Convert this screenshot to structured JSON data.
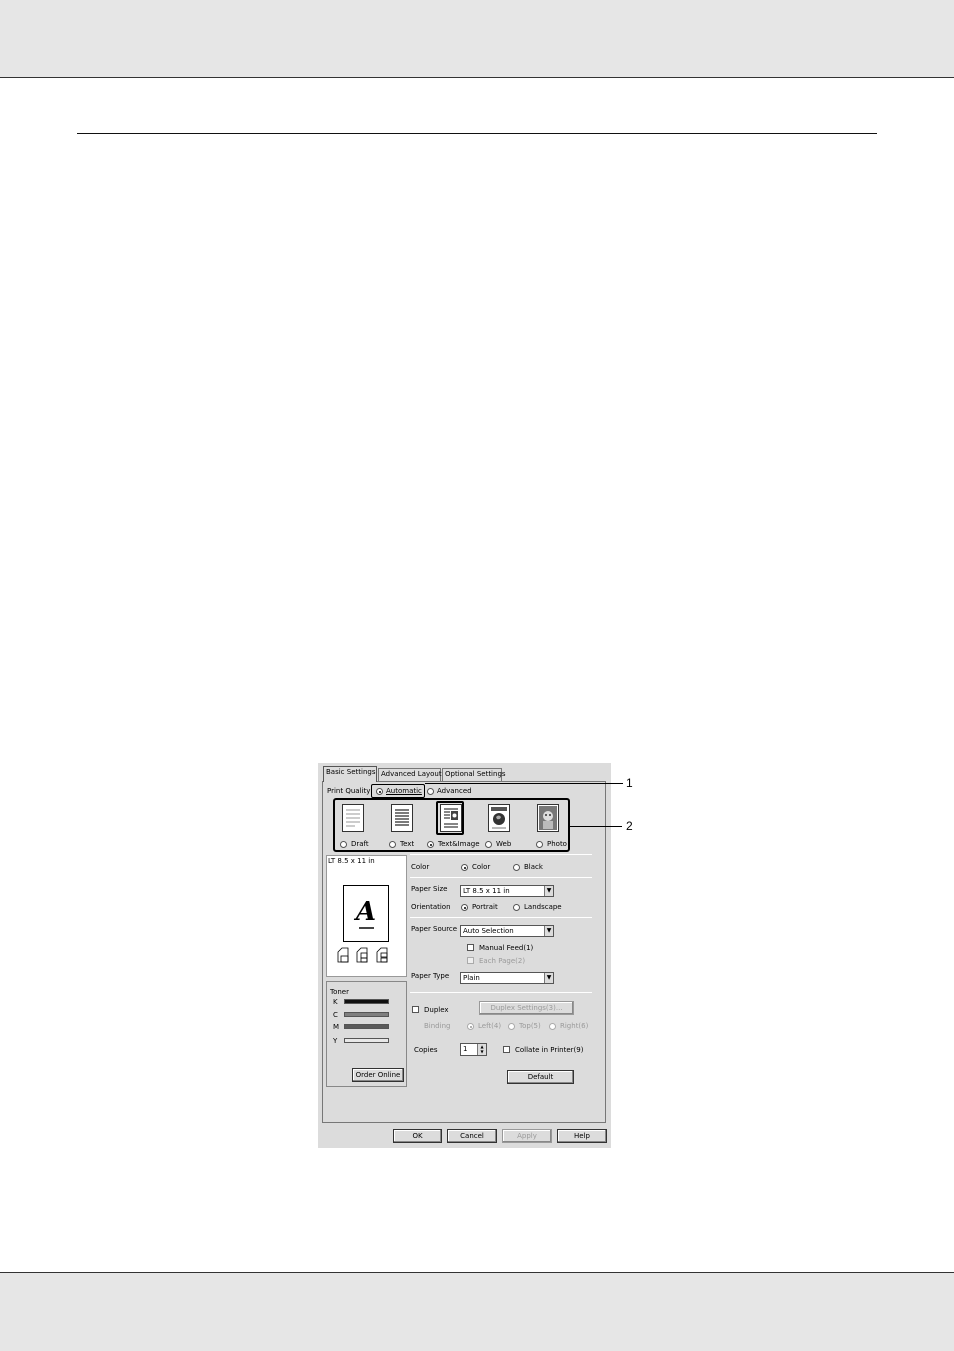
{
  "dialog": {
    "tabs": [
      "Basic Settings",
      "Advanced Layout",
      "Optional Settings"
    ],
    "print_quality": {
      "label": "Print Quality",
      "modes": [
        {
          "label": "Automatic",
          "selected": true
        },
        {
          "label": "Advanced",
          "selected": false
        }
      ],
      "options": [
        {
          "label": "Draft",
          "selected": false,
          "icon": "document-lines-icon"
        },
        {
          "label": "Text",
          "selected": false,
          "icon": "text-page-icon"
        },
        {
          "label": "Text&Image",
          "selected": true,
          "icon": "text-image-page-icon"
        },
        {
          "label": "Web",
          "selected": false,
          "icon": "globe-page-icon"
        },
        {
          "label": "Photo",
          "selected": false,
          "icon": "photo-icon"
        }
      ]
    },
    "preview": {
      "paper_label": "LT 8.5 x 11 in",
      "letter": "A"
    },
    "color": {
      "label": "Color",
      "options": [
        {
          "label": "Color",
          "selected": true
        },
        {
          "label": "Black",
          "selected": false
        }
      ]
    },
    "paper_size": {
      "label": "Paper Size",
      "value": "LT 8.5 x 11 in"
    },
    "orientation": {
      "label": "Orientation",
      "options": [
        {
          "label": "Portrait",
          "selected": true
        },
        {
          "label": "Landscape",
          "selected": false
        }
      ]
    },
    "paper_source": {
      "label": "Paper Source",
      "value": "Auto Selection"
    },
    "manual_feed": {
      "label": "Manual Feed(1)",
      "checked": false
    },
    "each_page": {
      "label": "Each Page(2)",
      "checked": false,
      "enabled": false
    },
    "paper_type": {
      "label": "Paper Type",
      "value": "Plain"
    },
    "toner": {
      "label": "Toner",
      "colors": [
        {
          "code": "K",
          "color": "#111111"
        },
        {
          "code": "C",
          "color": "#7f7f7f"
        },
        {
          "code": "M",
          "color": "#5a5a5a"
        },
        {
          "code": "Y",
          "color": "#e8e8e8"
        }
      ],
      "order_button": "Order Online"
    },
    "duplex": {
      "label": "Duplex",
      "checked": false,
      "settings_button": "Duplex Settings(3)..."
    },
    "binding": {
      "label": "Binding",
      "options": [
        {
          "label": "Left(4)",
          "selected": true
        },
        {
          "label": "Top(5)",
          "selected": false
        },
        {
          "label": "Right(6)",
          "selected": false
        }
      ]
    },
    "copies": {
      "label": "Copies",
      "value": "1"
    },
    "collate": {
      "label": "Collate in Printer(9)",
      "checked": false
    },
    "default_button": "Default",
    "footer_buttons": [
      "OK",
      "Cancel",
      "Apply",
      "Help"
    ]
  },
  "callouts": [
    "1",
    "2"
  ]
}
